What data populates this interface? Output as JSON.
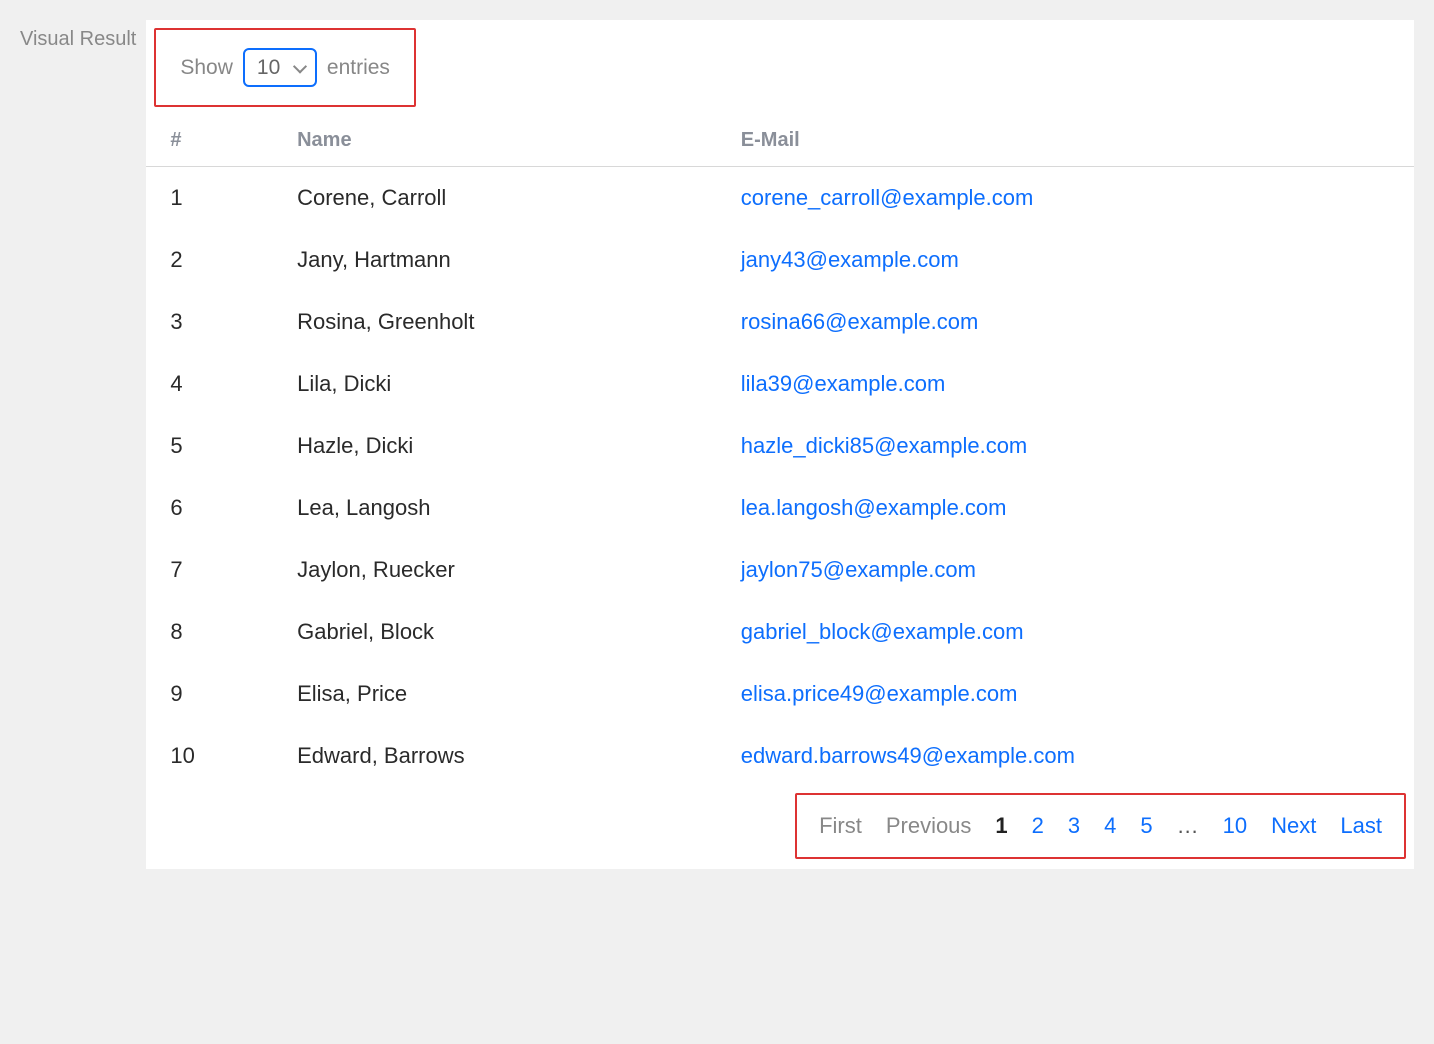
{
  "side_label": "Visual Result",
  "entries": {
    "show_label": "Show",
    "entries_label": "entries",
    "selected": "10"
  },
  "columns": {
    "id": "#",
    "name": "Name",
    "email": "E-Mail"
  },
  "rows": [
    {
      "id": "1",
      "name": "Corene, Carroll",
      "email": "corene_carroll@example.com"
    },
    {
      "id": "2",
      "name": "Jany, Hartmann",
      "email": "jany43@example.com"
    },
    {
      "id": "3",
      "name": "Rosina, Greenholt",
      "email": "rosina66@example.com"
    },
    {
      "id": "4",
      "name": "Lila, Dicki",
      "email": "lila39@example.com"
    },
    {
      "id": "5",
      "name": "Hazle, Dicki",
      "email": "hazle_dicki85@example.com"
    },
    {
      "id": "6",
      "name": "Lea, Langosh",
      "email": "lea.langosh@example.com"
    },
    {
      "id": "7",
      "name": "Jaylon, Ruecker",
      "email": "jaylon75@example.com"
    },
    {
      "id": "8",
      "name": "Gabriel, Block",
      "email": "gabriel_block@example.com"
    },
    {
      "id": "9",
      "name": "Elisa, Price",
      "email": "elisa.price49@example.com"
    },
    {
      "id": "10",
      "name": "Edward, Barrows",
      "email": "edward.barrows49@example.com"
    }
  ],
  "pagination": {
    "first": "First",
    "previous": "Previous",
    "pages_head": [
      "1",
      "2",
      "3",
      "4",
      "5"
    ],
    "ellipsis": "…",
    "last_page": "10",
    "next": "Next",
    "last": "Last",
    "current": "1"
  }
}
